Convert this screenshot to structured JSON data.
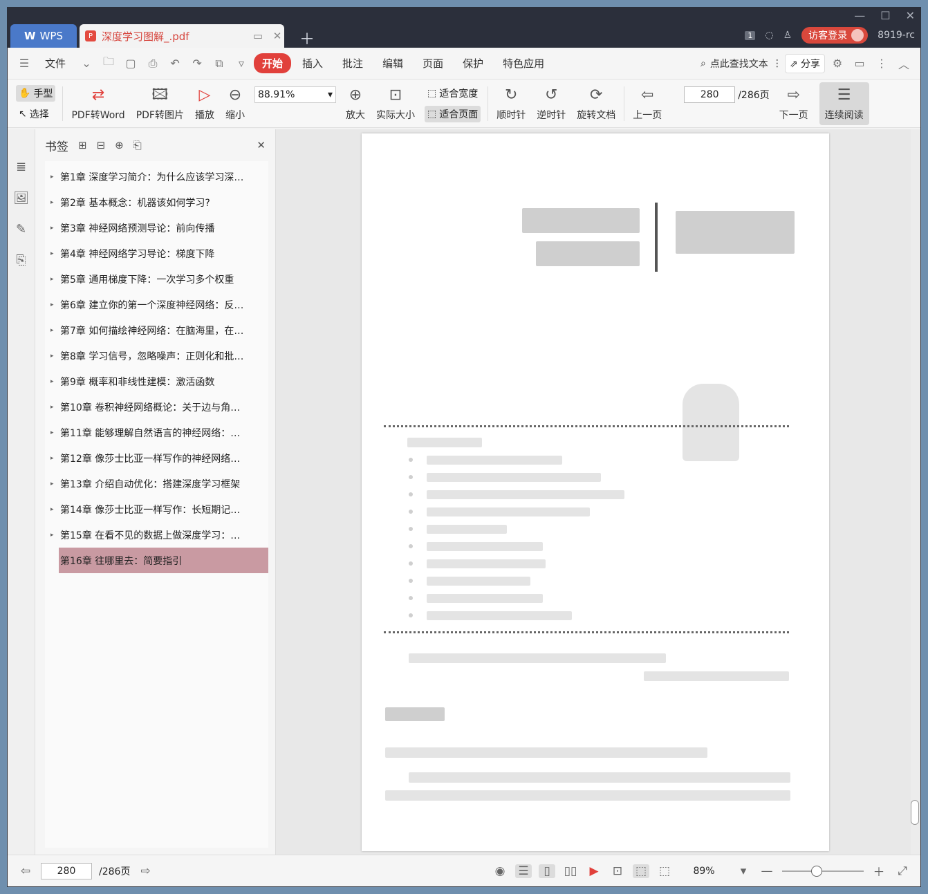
{
  "titlebar": {
    "app_tab": "WPS",
    "doc_tab": "深度学习图解_.pdf",
    "badge": "1",
    "guest_label": "访客登录",
    "user": "8919-rc"
  },
  "menubar": {
    "file": "文件",
    "tabs": [
      "开始",
      "插入",
      "批注",
      "编辑",
      "页面",
      "保护",
      "特色应用"
    ],
    "search": "点此查找文本",
    "share": "分享"
  },
  "toolbar": {
    "hand": "手型",
    "select": "选择",
    "pdf_to_word": "PDF转Word",
    "pdf_to_image": "PDF转图片",
    "play": "播放",
    "zoom_out": "缩小",
    "zoom_value": "88.91%",
    "zoom_in": "放大",
    "actual_size": "实际大小",
    "fit_width": "适合宽度",
    "fit_page": "适合页面",
    "clockwise": "顺时针",
    "counterclockwise": "逆时针",
    "rotate_doc": "旋转文档",
    "prev_page": "上一页",
    "page_value": "280",
    "page_total": "/286页",
    "next_page": "下一页",
    "continuous": "连续阅读"
  },
  "bookmarks": {
    "title": "书签",
    "items": [
      {
        "label": "第1章 深度学习简介：为什么应该学习深…",
        "selected": false
      },
      {
        "label": "第2章 基本概念：机器该如何学习?",
        "selected": false
      },
      {
        "label": "第3章 神经网络预测导论：前向传播",
        "selected": false
      },
      {
        "label": "第4章 神经网络学习导论：梯度下降",
        "selected": false
      },
      {
        "label": "第5章 通用梯度下降：一次学习多个权重",
        "selected": false
      },
      {
        "label": "第6章 建立你的第一个深度神经网络：反…",
        "selected": false
      },
      {
        "label": "第7章 如何描绘神经网络：在脑海里，在…",
        "selected": false
      },
      {
        "label": "第8章 学习信号，忽略噪声：正则化和批…",
        "selected": false
      },
      {
        "label": "第9章 概率和非线性建模：激活函数",
        "selected": false
      },
      {
        "label": "第10章 卷积神经网络概论：关于边与角…",
        "selected": false
      },
      {
        "label": "第11章 能够理解自然语言的神经网络：…",
        "selected": false
      },
      {
        "label": "第12章 像莎士比亚一样写作的神经网络…",
        "selected": false
      },
      {
        "label": "第13章 介绍自动优化：搭建深度学习框架",
        "selected": false
      },
      {
        "label": "第14章 像莎士比亚一样写作：长短期记…",
        "selected": false
      },
      {
        "label": "第15章 在看不见的数据上做深度学习：…",
        "selected": false
      },
      {
        "label": "第16章 往哪里去：简要指引",
        "selected": true
      }
    ]
  },
  "statusbar": {
    "page_value": "280",
    "page_total": "/286页",
    "zoom": "89%"
  },
  "colors": {
    "accent": "#e1403b",
    "wps_blue": "#4a79c9",
    "bookmark_selected": "#c99aa2"
  }
}
